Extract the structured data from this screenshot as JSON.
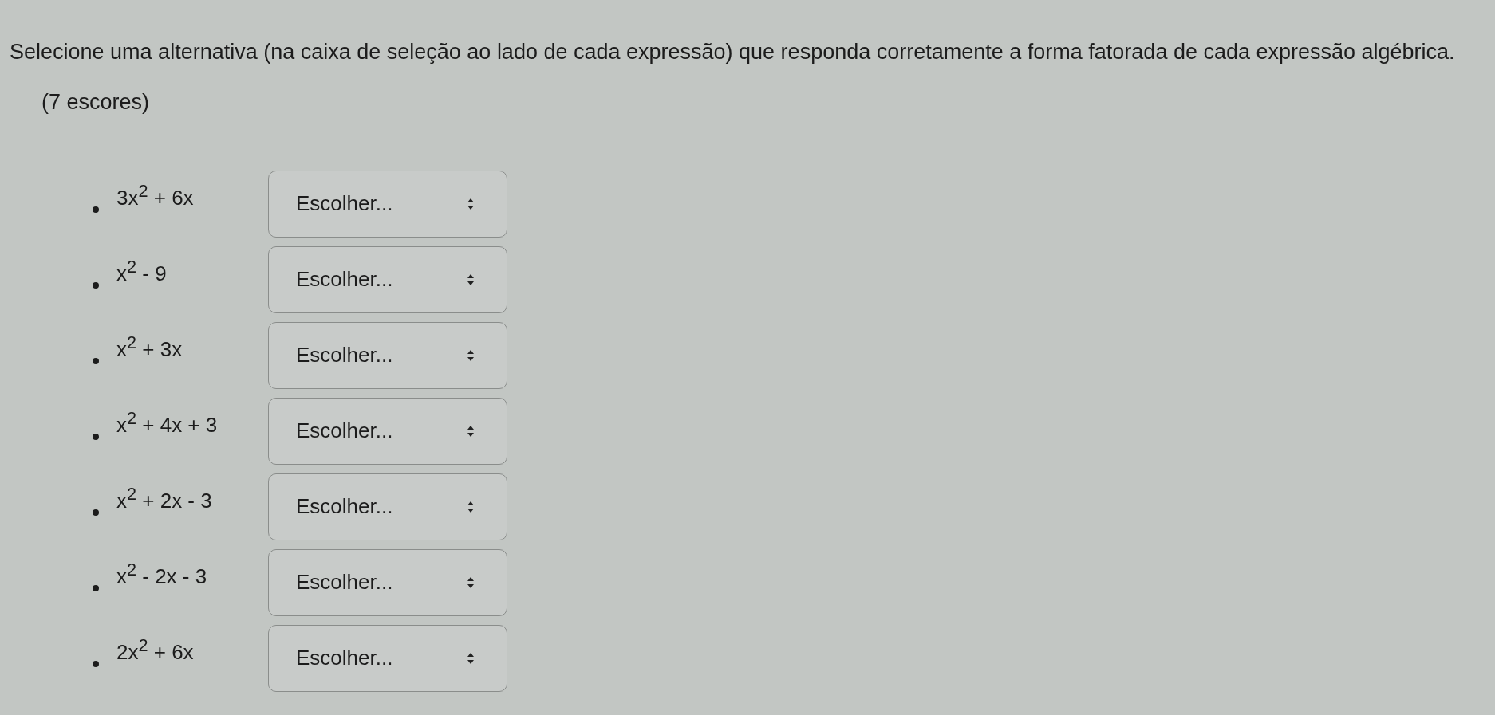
{
  "question": {
    "text": "Selecione uma alternativa (na caixa de seleção ao lado de cada expressão) que responda corretamente a forma fatorada de cada expressão algébrica.",
    "score": "(7 escores)"
  },
  "items": [
    {
      "expression": "3x$^{2}$ + 6x",
      "choice": "Escolher..."
    },
    {
      "expression": "x$^{2}$ - 9",
      "choice": "Escolher..."
    },
    {
      "expression": "x$^{2}$ + 3x",
      "choice": "Escolher..."
    },
    {
      "expression": "x$^{2}$ + 4x + 3",
      "choice": "Escolher..."
    },
    {
      "expression": "x$^{2}$ + 2x - 3",
      "choice": "Escolher..."
    },
    {
      "expression": "x$^{2}$ - 2x - 3",
      "choice": "Escolher..."
    },
    {
      "expression": "2x$^{2}$ + 6x",
      "choice": "Escolher..."
    }
  ]
}
